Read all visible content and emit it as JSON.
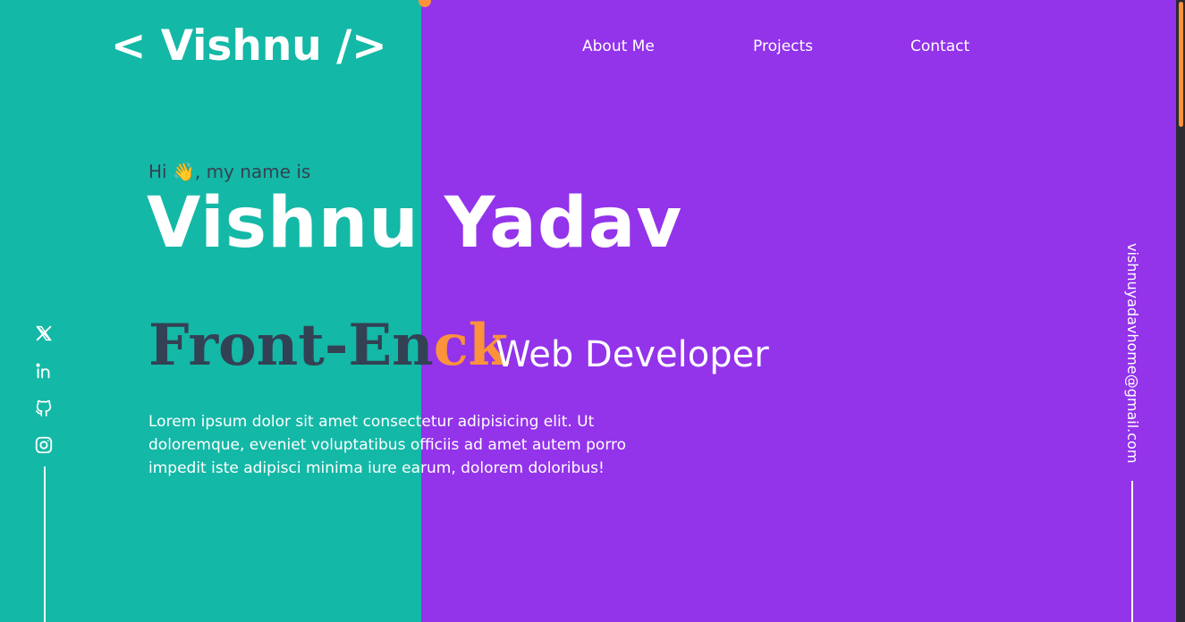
{
  "header": {
    "logo": "< Vishnu />",
    "nav": [
      {
        "label": "About Me"
      },
      {
        "label": "Projects"
      },
      {
        "label": "Contact"
      }
    ]
  },
  "hero": {
    "greeting": "Hi 👋, my name is",
    "name": "Vishnu Yadav",
    "role_typed_prefix": "Front-En",
    "role_typed_accent": "ck",
    "role_suffix": "Web Developer",
    "bio": "Lorem ipsum dolor sit amet consectetur adipisicing elit. Ut doloremque, eveniet voluptatibus officiis ad amet autem porro impedit iste adipisci minima iure earum, dolorem doloribus!"
  },
  "socials": [
    {
      "icon": "x-twitter-icon"
    },
    {
      "icon": "linkedin-icon"
    },
    {
      "icon": "github-icon"
    },
    {
      "icon": "instagram-icon"
    }
  ],
  "email": "vishnuyadavhome@gmail.com",
  "colors": {
    "left_panel": "#14b8a6",
    "right_panel": "#9333ea",
    "accent": "#fb923c",
    "dark_text": "#334155"
  }
}
